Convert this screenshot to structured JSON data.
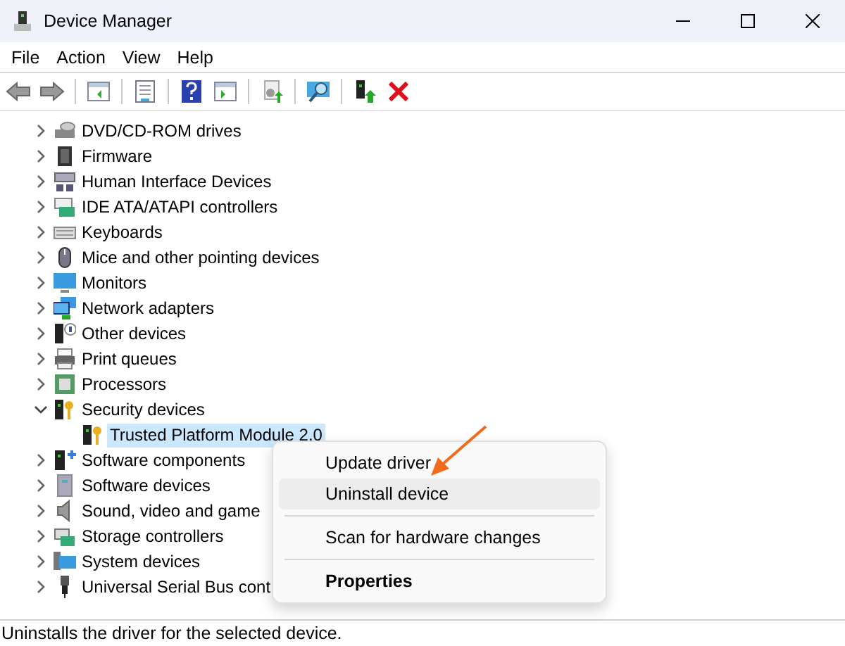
{
  "window": {
    "title": "Device Manager"
  },
  "menu_bar": [
    "File",
    "Action",
    "View",
    "Help"
  ],
  "tree": [
    {
      "label": "DVD/CD-ROM drives",
      "expanded": false
    },
    {
      "label": "Firmware",
      "expanded": false
    },
    {
      "label": "Human Interface Devices",
      "expanded": false
    },
    {
      "label": "IDE ATA/ATAPI controllers",
      "expanded": false
    },
    {
      "label": "Keyboards",
      "expanded": false
    },
    {
      "label": "Mice and other pointing devices",
      "expanded": false
    },
    {
      "label": "Monitors",
      "expanded": false
    },
    {
      "label": "Network adapters",
      "expanded": false
    },
    {
      "label": "Other devices",
      "expanded": false
    },
    {
      "label": "Print queues",
      "expanded": false
    },
    {
      "label": "Processors",
      "expanded": false
    },
    {
      "label": "Security devices",
      "expanded": true,
      "children": [
        {
          "label": "Trusted Platform Module 2.0",
          "selected": true
        }
      ]
    },
    {
      "label": "Software components",
      "expanded": false
    },
    {
      "label": "Software devices",
      "expanded": false
    },
    {
      "label": "Sound, video and game",
      "expanded": false
    },
    {
      "label": "Storage controllers",
      "expanded": false
    },
    {
      "label": "System devices",
      "expanded": false
    },
    {
      "label": "Universal Serial Bus cont",
      "expanded": false
    }
  ],
  "context_menu": [
    {
      "kind": "item",
      "label": "Update driver",
      "highlighted": false,
      "bold": false
    },
    {
      "kind": "item",
      "label": "Uninstall device",
      "highlighted": true,
      "bold": false
    },
    {
      "kind": "separator"
    },
    {
      "kind": "item",
      "label": "Scan for hardware changes",
      "highlighted": false,
      "bold": false
    },
    {
      "kind": "separator"
    },
    {
      "kind": "item",
      "label": "Properties",
      "highlighted": false,
      "bold": true
    }
  ],
  "status_bar": "Uninstalls the driver for the selected device."
}
